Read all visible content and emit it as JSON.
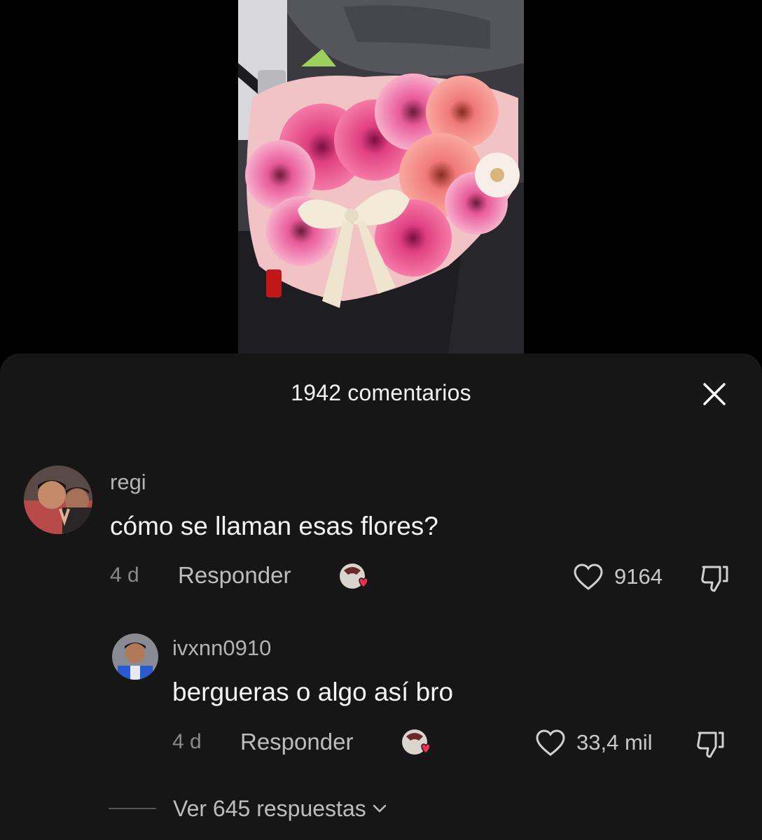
{
  "video": {
    "description_icon": "flower-bouquet-image"
  },
  "comments_panel": {
    "title": "1942 comentarios",
    "close_icon": "close-icon"
  },
  "comments": [
    {
      "username": "regi",
      "text": "cómo se llaman esas flores?",
      "time": "4 d",
      "reply_label": "Responder",
      "likes": "9164"
    },
    {
      "username": "ivxnn0910",
      "text": "bergueras o algo así bro",
      "time": "4 d",
      "reply_label": "Responder",
      "likes": "33,4 mil"
    }
  ],
  "view_replies": {
    "label": "Ver 645 respuestas"
  },
  "colors": {
    "background": "#000000",
    "sheet": "#161616",
    "heart_badge": "#fe2c55"
  }
}
